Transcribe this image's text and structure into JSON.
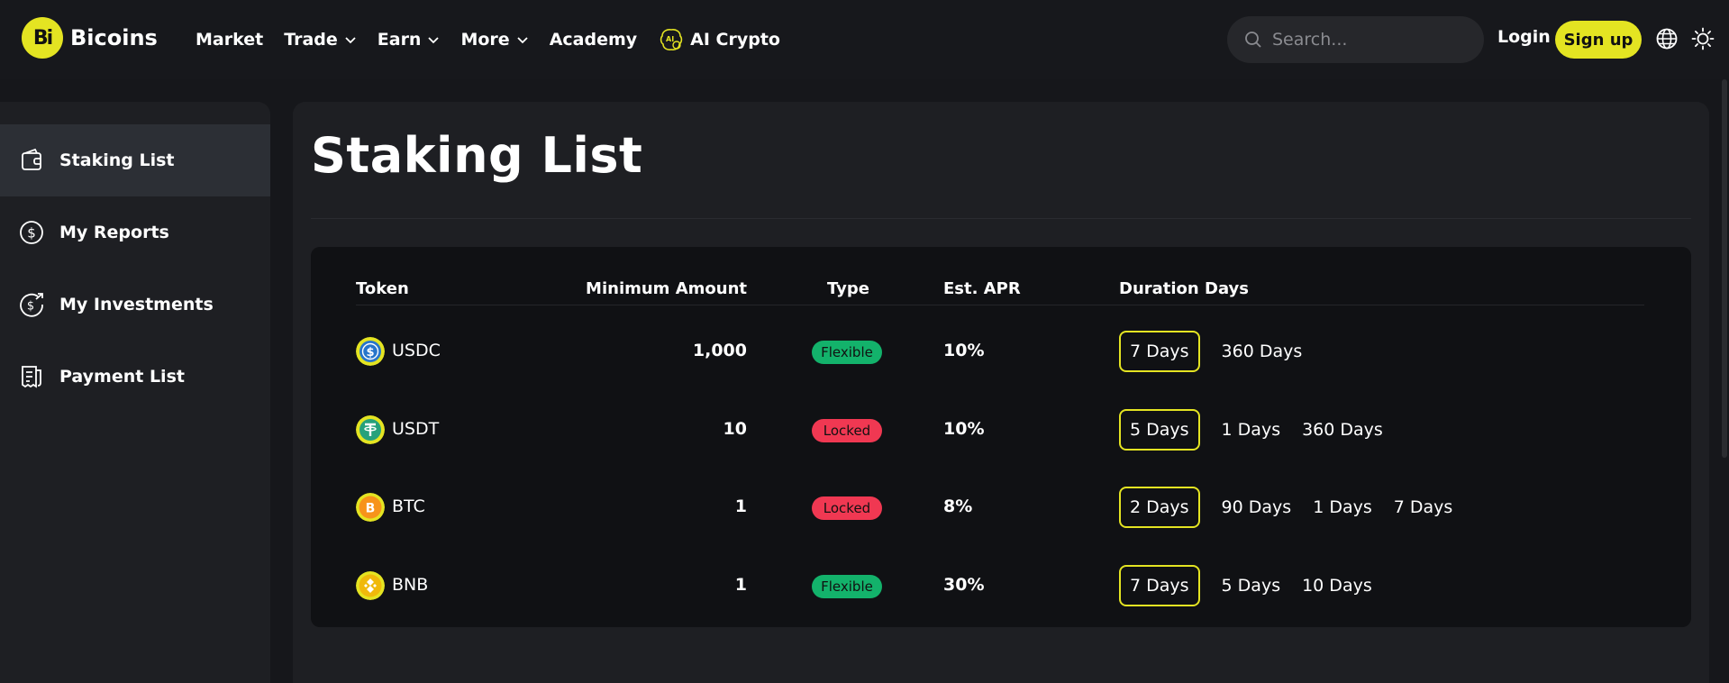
{
  "header": {
    "logo_badge": "Bi",
    "logo_text": "Bicoins",
    "nav": {
      "market": "Market",
      "trade": "Trade",
      "earn": "Earn",
      "more": "More",
      "academy": "Academy",
      "ai_crypto": "AI Crypto"
    },
    "search_placeholder": "Search...",
    "login": "Login",
    "signup": "Sign up",
    "accent_color": "#e4e422"
  },
  "sidebar": {
    "items": [
      {
        "label": "Staking List",
        "icon": "wallet-icon",
        "active": true
      },
      {
        "label": "My Reports",
        "icon": "dollar-circle-icon",
        "active": false
      },
      {
        "label": "My Investments",
        "icon": "investment-icon",
        "active": false
      },
      {
        "label": "Payment List",
        "icon": "receipt-icon",
        "active": false
      }
    ]
  },
  "main": {
    "title": "Staking List",
    "table": {
      "headers": {
        "token": "Token",
        "min_amount": "Minimum Amount",
        "type": "Type",
        "apr": "Est. APR",
        "duration": "Duration Days"
      },
      "rows": [
        {
          "token": "USDC",
          "icon": "usdc-icon",
          "min": "1,000",
          "type": "Flexible",
          "apr": "10%",
          "durations": [
            "7 Days",
            "360 Days"
          ]
        },
        {
          "token": "USDT",
          "icon": "usdt-icon",
          "min": "10",
          "type": "Locked",
          "apr": "10%",
          "durations": [
            "5 Days",
            "1 Days",
            "360 Days"
          ]
        },
        {
          "token": "BTC",
          "icon": "btc-icon",
          "min": "1",
          "type": "Locked",
          "apr": "8%",
          "durations": [
            "2 Days",
            "90 Days",
            "1 Days",
            "7 Days"
          ]
        },
        {
          "token": "BNB",
          "icon": "bnb-icon",
          "min": "1",
          "type": "Flexible",
          "apr": "30%",
          "durations": [
            "7 Days",
            "5 Days",
            "10 Days"
          ]
        }
      ]
    },
    "colors": {
      "flexible": "#13b26b",
      "locked": "#f03852"
    }
  }
}
